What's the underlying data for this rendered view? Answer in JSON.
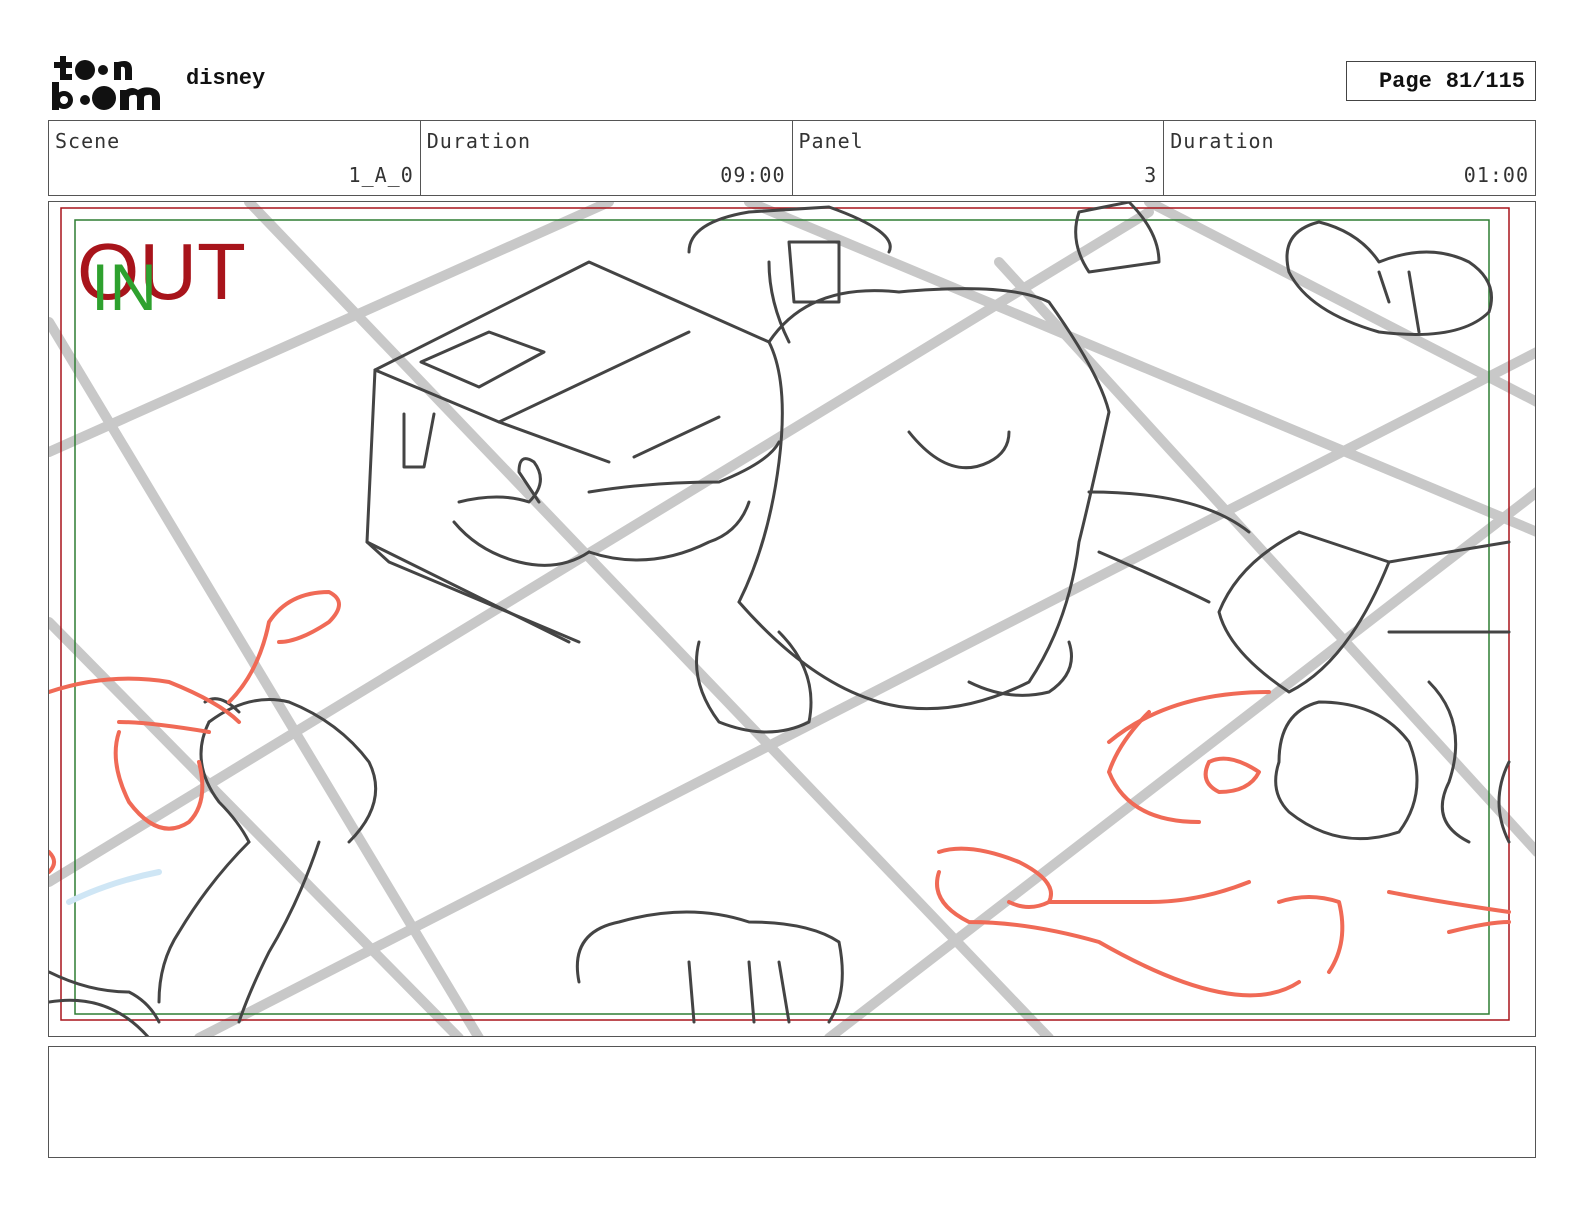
{
  "header": {
    "logo_text": "toon boom",
    "project": "disney",
    "page_label": "Page",
    "page_value": "81/115"
  },
  "info": {
    "scene_label": "Scene",
    "scene_value": "1_A_0",
    "duration_label": "Duration",
    "duration_value": "09:00",
    "panel_label": "Panel",
    "panel_value": "3",
    "panel_duration_label": "Duration",
    "panel_duration_value": "01:00"
  },
  "panel": {
    "out_label": "OUT",
    "in_label": "IN",
    "colors": {
      "out": "#a8141b",
      "in": "#2ea12e",
      "safe_frame": "#2e7d32",
      "cam_frame": "#a8141b",
      "sketch": "#444444",
      "red_sketch": "#f06a56"
    }
  },
  "notes": {
    "text": ""
  }
}
